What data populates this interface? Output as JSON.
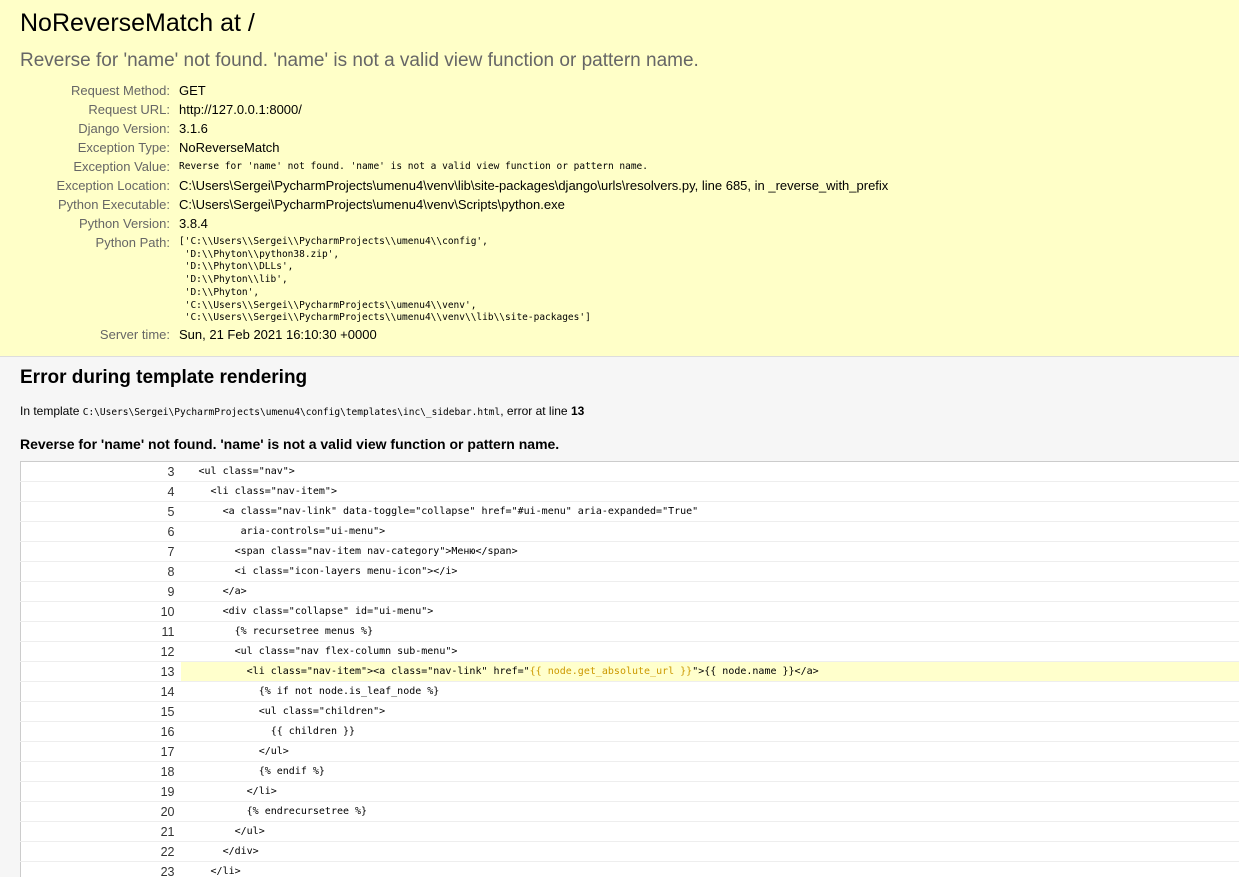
{
  "summary": {
    "title": "NoReverseMatch at /",
    "subtitle": "Reverse for 'name' not found. 'name' is not a valid view function or pattern name.",
    "meta": [
      {
        "label": "Request Method:",
        "value": "GET",
        "mono": false
      },
      {
        "label": "Request URL:",
        "value": "http://127.0.0.1:8000/",
        "mono": false
      },
      {
        "label": "Django Version:",
        "value": "3.1.6",
        "mono": false
      },
      {
        "label": "Exception Type:",
        "value": "NoReverseMatch",
        "mono": false
      },
      {
        "label": "Exception Value:",
        "value": "Reverse for 'name' not found. 'name' is not a valid view function or pattern name.",
        "mono": true
      },
      {
        "label": "Exception Location:",
        "value": "C:\\Users\\Sergei\\PycharmProjects\\umenu4\\venv\\lib\\site-packages\\django\\urls\\resolvers.py, line 685, in _reverse_with_prefix",
        "mono": false
      },
      {
        "label": "Python Executable:",
        "value": "C:\\Users\\Sergei\\PycharmProjects\\umenu4\\venv\\Scripts\\python.exe",
        "mono": false
      },
      {
        "label": "Python Version:",
        "value": "3.8.4",
        "mono": false
      }
    ],
    "python_path_label": "Python Path:",
    "python_path": "['C:\\\\Users\\\\Sergei\\\\PycharmProjects\\\\umenu4\\\\config',\n 'D:\\\\Phyton\\\\python38.zip',\n 'D:\\\\Phyton\\\\DLLs',\n 'D:\\\\Phyton\\\\lib',\n 'D:\\\\Phyton',\n 'C:\\\\Users\\\\Sergei\\\\PycharmProjects\\\\umenu4\\\\venv',\n 'C:\\\\Users\\\\Sergei\\\\PycharmProjects\\\\umenu4\\\\venv\\\\lib\\\\site-packages']",
    "server_time_label": "Server time:",
    "server_time": "Sun, 21 Feb 2021 16:10:30 +0000"
  },
  "template": {
    "heading": "Error during template rendering",
    "in_template_prefix": "In template",
    "template_path": "C:\\Users\\Sergei\\PycharmProjects\\umenu4\\config\\templates\\inc\\_sidebar.html",
    "error_at_text": ", error at line",
    "error_line": "13",
    "message": "Reverse for 'name' not found. 'name' is not a valid view function or pattern name.",
    "lines": [
      {
        "num": "3",
        "code": "<ul class=\"nav\">"
      },
      {
        "num": "4",
        "code": "  <li class=\"nav-item\">"
      },
      {
        "num": "5",
        "code": "    <a class=\"nav-link\" data-toggle=\"collapse\" href=\"#ui-menu\" aria-expanded=\"True\""
      },
      {
        "num": "6",
        "code": "       aria-controls=\"ui-menu\">"
      },
      {
        "num": "7",
        "code": "      <span class=\"nav-item nav-category\">Меню</span>"
      },
      {
        "num": "8",
        "code": "      <i class=\"icon-layers menu-icon\"></i>"
      },
      {
        "num": "9",
        "code": "    </a>"
      },
      {
        "num": "10",
        "code": "    <div class=\"collapse\" id=\"ui-menu\">"
      },
      {
        "num": "11",
        "code": "      {% recursetree menus %}"
      },
      {
        "num": "12",
        "code": "      <ul class=\"nav flex-column sub-menu\">"
      },
      {
        "num": "13",
        "before": "        <li class=\"nav-item\"><a class=\"nav-link\" href=\"",
        "specific": "{{ node.get_absolute_url }}",
        "after": "\">{{ node.name }}</a>",
        "error": true
      },
      {
        "num": "14",
        "code": "          {% if not node.is_leaf_node %}"
      },
      {
        "num": "15",
        "code": "          <ul class=\"children\">"
      },
      {
        "num": "16",
        "code": "            {{ children }}"
      },
      {
        "num": "17",
        "code": "          </ul>"
      },
      {
        "num": "18",
        "code": "          {% endif %}"
      },
      {
        "num": "19",
        "code": "        </li>"
      },
      {
        "num": "20",
        "code": "        {% endrecursetree %}"
      },
      {
        "num": "21",
        "code": "      </ul>"
      },
      {
        "num": "22",
        "code": "    </div>"
      },
      {
        "num": "23",
        "code": "  </li>"
      }
    ]
  }
}
